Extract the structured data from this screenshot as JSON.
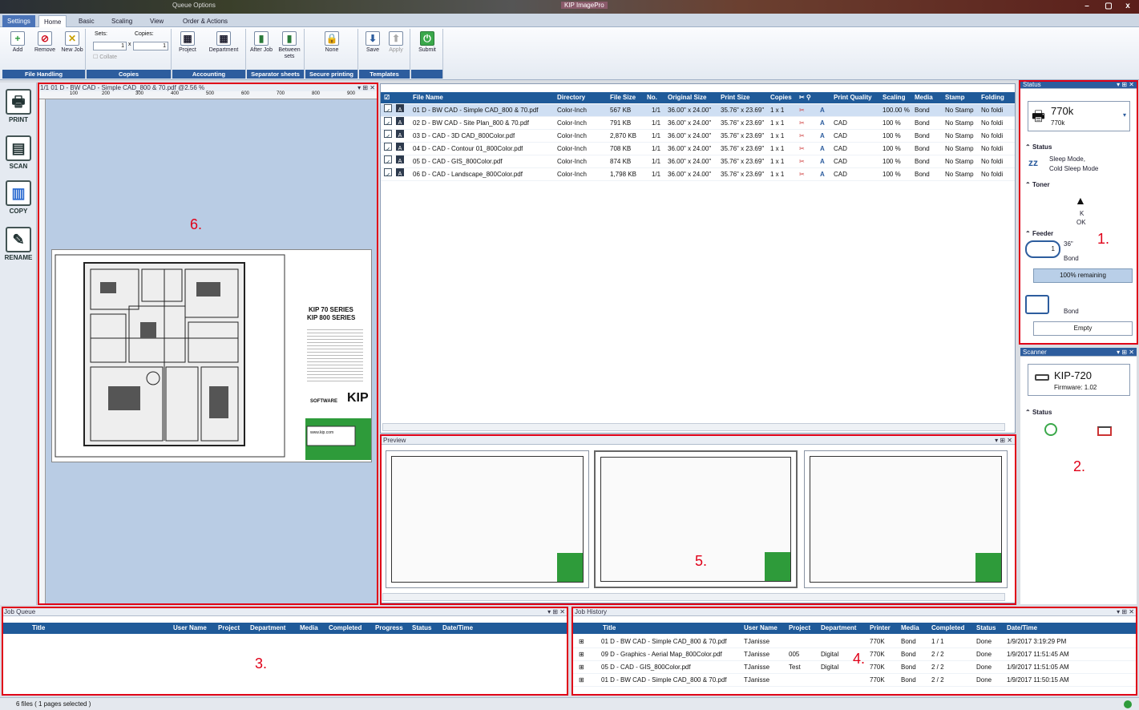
{
  "titlebar": {
    "left_title": "Queue Options",
    "center_title": "KIP ImagePro",
    "minimize": "–",
    "maximize": "▢",
    "close": "x"
  },
  "ribbon_tabs": [
    "Settings",
    "Home",
    "Basic",
    "Scaling",
    "View",
    "Order & Actions"
  ],
  "ribbon": {
    "file_handling": {
      "add": "Add",
      "remove": "Remove",
      "new_job": "New Job",
      "footer": "File Handling"
    },
    "copies": {
      "sets_label": "Sets:",
      "copies_label": "Copies:",
      "sets_value": "1",
      "copies_value": "1",
      "times": "x",
      "collate": "Collate",
      "footer": "Copies"
    },
    "accounting": {
      "project": "Project",
      "department": "Department",
      "footer": "Accounting"
    },
    "separator": {
      "after_job": "After Job",
      "between_sets": "Between sets",
      "footer": "Separator sheets"
    },
    "secure": {
      "none": "None",
      "footer": "Secure printing"
    },
    "templates": {
      "save": "Save",
      "apply": "Apply",
      "footer": "Templates"
    },
    "submit": {
      "label": "Submit"
    }
  },
  "leftbar": {
    "print": "PRINT",
    "scan": "SCAN",
    "copy": "COPY",
    "rename": "RENAME"
  },
  "viewer": {
    "header": "1/1  01 D - BW CAD - Simple CAD_800 & 70.pdf  @2.56 %",
    "ruler_ticks": [
      "100",
      "200",
      "300",
      "400",
      "500",
      "600",
      "700",
      "800",
      "900"
    ],
    "sheet_title1": "KIP 70 SERIES",
    "sheet_title2": "KIP 800 SERIES",
    "sheet_url": "www.kip.com",
    "sheet_logo": "KIP",
    "sheet_software": "SOFTWARE",
    "region_label": "6."
  },
  "filetable": {
    "headers": [
      "File Name",
      "Directory",
      "File Size",
      "No.",
      "Original Size",
      "Print Size",
      "Copies",
      "Print Quality",
      "Scaling",
      "Media",
      "Stamp",
      "Folding"
    ],
    "rows": [
      {
        "name": "01 D - BW CAD - Simple CAD_800 & 70.pdf",
        "dir": "Color-Inch",
        "size": "567 KB",
        "no": "1/1",
        "orig": "36.00\" x 24.00\"",
        "print": "35.76\" x 23.69\"",
        "copies": "1 x 1",
        "quality_icon": "A",
        "quality": "",
        "scaling": "100.00 %",
        "media": "Bond",
        "stamp": "No Stamp",
        "folding": "No foldi"
      },
      {
        "name": "02 D - BW CAD - Site Plan_800 & 70.pdf",
        "dir": "Color-Inch",
        "size": "791 KB",
        "no": "1/1",
        "orig": "36.00\" x 24.00\"",
        "print": "35.76\" x 23.69\"",
        "copies": "1 x 1",
        "quality_icon": "A",
        "quality": "CAD",
        "scaling": "100 %",
        "media": "Bond",
        "stamp": "No Stamp",
        "folding": "No foldi"
      },
      {
        "name": "03 D - CAD - 3D CAD_800Color.pdf",
        "dir": "Color-Inch",
        "size": "2,870 KB",
        "no": "1/1",
        "orig": "36.00\" x 24.00\"",
        "print": "35.76\" x 23.69\"",
        "copies": "1 x 1",
        "quality_icon": "A",
        "quality": "CAD",
        "scaling": "100 %",
        "media": "Bond",
        "stamp": "No Stamp",
        "folding": "No foldi"
      },
      {
        "name": "04 D - CAD - Contour 01_800Color.pdf",
        "dir": "Color-Inch",
        "size": "708 KB",
        "no": "1/1",
        "orig": "36.00\" x 24.00\"",
        "print": "35.76\" x 23.69\"",
        "copies": "1 x 1",
        "quality_icon": "A",
        "quality": "CAD",
        "scaling": "100 %",
        "media": "Bond",
        "stamp": "No Stamp",
        "folding": "No foldi"
      },
      {
        "name": "05 D - CAD - GIS_800Color.pdf",
        "dir": "Color-Inch",
        "size": "874 KB",
        "no": "1/1",
        "orig": "36.00\" x 24.00\"",
        "print": "35.76\" x 23.69\"",
        "copies": "1 x 1",
        "quality_icon": "A",
        "quality": "CAD",
        "scaling": "100 %",
        "media": "Bond",
        "stamp": "No Stamp",
        "folding": "No foldi"
      },
      {
        "name": "06 D - CAD - Landscape_800Color.pdf",
        "dir": "Color-Inch",
        "size": "1,798 KB",
        "no": "1/1",
        "orig": "36.00\" x 24.00\"",
        "print": "35.76\" x 23.69\"",
        "copies": "1 x 1",
        "quality_icon": "A",
        "quality": "CAD",
        "scaling": "100 %",
        "media": "Bond",
        "stamp": "No Stamp",
        "folding": "No foldi"
      }
    ]
  },
  "preview": {
    "title": "Preview",
    "region_label": "5."
  },
  "status_panel": {
    "title": "Status",
    "printer": "770k",
    "printer_sub": "770k",
    "status_label": "Status",
    "sleep1": "Sleep Mode,",
    "sleep2": "Cold Sleep Mode",
    "toner_label": "Toner",
    "toner_k": "K",
    "toner_ok": "OK",
    "feeder_label": "Feeder",
    "feeder_num": "1",
    "feeder_size": "36\"",
    "feeder_media": "Bond",
    "remaining": "100% remaining",
    "tray_media": "Bond",
    "empty": "Empty",
    "region_label": "1."
  },
  "scanner_panel": {
    "title": "Scanner",
    "model": "KIP-720",
    "firmware": "Firmware: 1.02",
    "status_label": "Status",
    "region_label": "2."
  },
  "job_queue": {
    "title": "Job Queue",
    "headers": [
      "Title",
      "User Name",
      "Project",
      "Department",
      "Media",
      "Completed",
      "Progress",
      "Status",
      "Date/Time"
    ],
    "region_label": "3."
  },
  "job_history": {
    "title": "Job History",
    "headers": [
      "Title",
      "User Name",
      "Project",
      "Department",
      "Printer",
      "Media",
      "Completed",
      "Status",
      "Date/Time"
    ],
    "rows": [
      {
        "title": "01 D - BW CAD - Simple CAD_800 & 70.pdf",
        "user": "TJanisse",
        "project": "",
        "dept": "",
        "printer": "770K",
        "media": "Bond",
        "completed": "1 / 1",
        "status": "Done",
        "date": "1/9/2017 3:19:29 PM"
      },
      {
        "title": "09 D - Graphics - Aerial Map_800Color.pdf",
        "user": "TJanisse",
        "project": "005",
        "dept": "Digital",
        "printer": "770K",
        "media": "Bond",
        "completed": "2 / 2",
        "status": "Done",
        "date": "1/9/2017 11:51:45 AM"
      },
      {
        "title": "05 D - CAD - GIS_800Color.pdf",
        "user": "TJanisse",
        "project": "Test",
        "dept": "Digital",
        "printer": "770K",
        "media": "Bond",
        "completed": "2 / 2",
        "status": "Done",
        "date": "1/9/2017 11:51:05 AM"
      },
      {
        "title": "01 D - BW CAD - Simple CAD_800 & 70.pdf",
        "user": "TJanisse",
        "project": "",
        "dept": "",
        "printer": "770K",
        "media": "Bond",
        "completed": "2 / 2",
        "status": "Done",
        "date": "1/9/2017 11:50:15 AM"
      }
    ],
    "region_label": "4."
  },
  "statusbar": {
    "text": "6 files   ( 1 pages selected )"
  },
  "colors": {
    "accent_red": "#e00018",
    "header_blue": "#1f5a99",
    "green": "#2e9b3a"
  }
}
